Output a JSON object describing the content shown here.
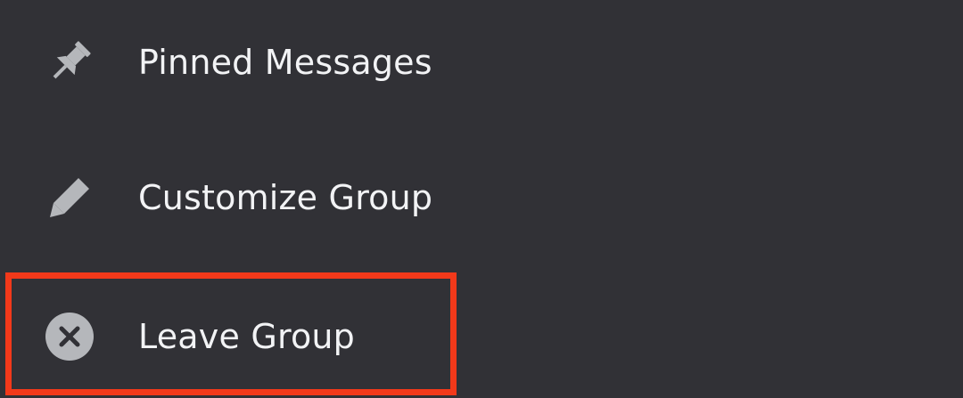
{
  "menu": {
    "items": [
      {
        "label": "Pinned Messages",
        "icon": "pin-icon"
      },
      {
        "label": "Customize Group",
        "icon": "pencil-icon"
      },
      {
        "label": "Leave Group",
        "icon": "close-circle-icon"
      }
    ]
  },
  "colors": {
    "background": "#313136",
    "text": "#f2f3f5",
    "icon": "#b5b7bb",
    "highlight": "#f2391a"
  }
}
